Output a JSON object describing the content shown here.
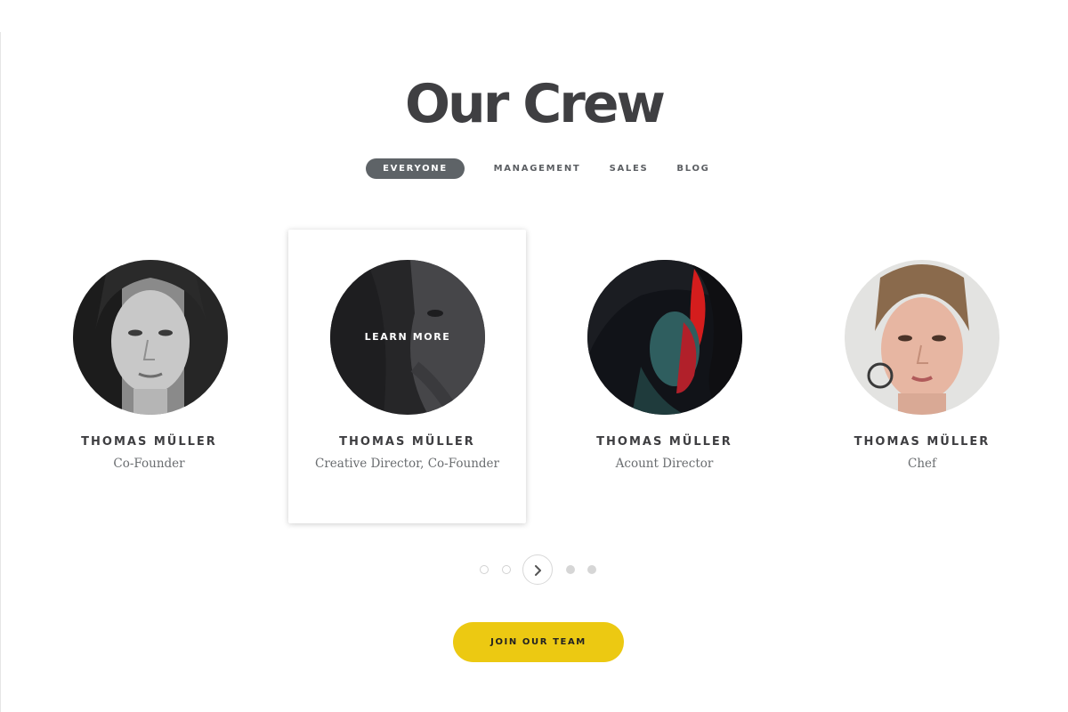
{
  "title": "Our Crew",
  "filters": [
    {
      "label": "EVERYONE",
      "active": true
    },
    {
      "label": "MANAGEMENT",
      "active": false
    },
    {
      "label": "SALES",
      "active": false
    },
    {
      "label": "BLOG",
      "active": false
    }
  ],
  "members": [
    {
      "name": "THOMAS MÜLLER",
      "role": "Co-Founder",
      "photo": "portrait-bw-woman"
    },
    {
      "name": "THOMAS MÜLLER",
      "role": "Creative Director, Co-Founder",
      "photo": "portrait-dark-woman",
      "overlay_label": "LEARN MORE"
    },
    {
      "name": "THOMAS MÜLLER",
      "role": "Acount Director",
      "photo": "portrait-red-teal-woman"
    },
    {
      "name": "THOMAS MÜLLER",
      "role": "Chef",
      "photo": "portrait-freckled-woman"
    }
  ],
  "pager": {
    "dots": 4,
    "next_icon": "chevron-right-icon"
  },
  "cta": {
    "label": "JOIN OUR TEAM"
  },
  "colors": {
    "accent": "#ecc912",
    "active_filter": "#5e6367",
    "heading": "#3f3f42"
  }
}
